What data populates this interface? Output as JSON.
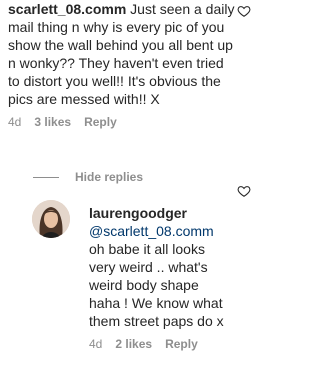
{
  "comment1": {
    "username": "scarlett_08.comm",
    "text": " Just seen a daily mail thing n why is every pic of you show the wall behind you all bent up n wonky?? They haven't even tried to distort you well!! It's obvious the pics are messed with!! X",
    "time": "4d",
    "likes": "3 likes",
    "reply": "Reply"
  },
  "replies_toggle": {
    "label": "Hide replies"
  },
  "comment2": {
    "username": "laurengoodger",
    "mention": "@scarlett_08.comm",
    "text": " oh babe it all looks very weird .. what's weird body shape haha ! We know what them street paps do x",
    "time": "4d",
    "likes": "2 likes",
    "reply": "Reply"
  },
  "icons": {
    "like": "heart-outline-icon",
    "avatar": "profile-avatar"
  },
  "colors": {
    "text": "#262626",
    "secondary": "#8e8e8e",
    "mention": "#00376b"
  }
}
